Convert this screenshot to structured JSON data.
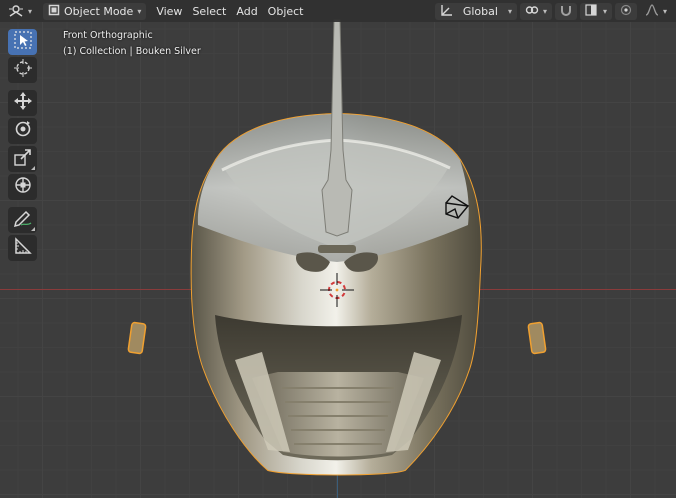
{
  "header": {
    "mode_label": "Object Mode",
    "menus": [
      "View",
      "Select",
      "Add",
      "Object"
    ],
    "orientation_label": "Global"
  },
  "overlay": {
    "view_name": "Front Orthographic",
    "collection_info": "(1) Collection | Bouken Silver"
  },
  "toolbar": {
    "tools": [
      "select-box",
      "cursor",
      "move",
      "rotate",
      "scale",
      "transform",
      "annotate",
      "measure"
    ],
    "active_tool": "select-box"
  },
  "colors": {
    "selection_outline": "#f0a030",
    "active_tool_bg": "#4772b3",
    "x_axis": "#8a3b3b",
    "y_axis": "#3a5d7a"
  }
}
